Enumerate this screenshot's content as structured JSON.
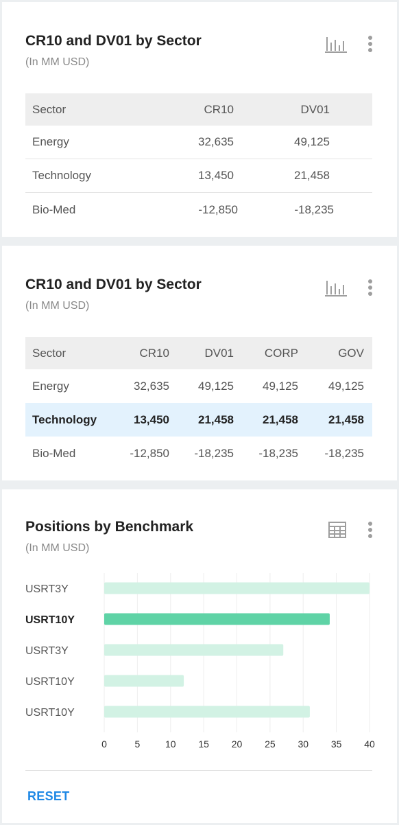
{
  "card1": {
    "title": "CR10 and DV01 by Sector",
    "subtitle": "(In MM USD)",
    "headers": [
      "Sector",
      "CR10",
      "DV01"
    ],
    "rows": [
      [
        "Energy",
        "32,635",
        "49,125"
      ],
      [
        "Technology",
        "13,450",
        "21,458"
      ],
      [
        "Bio-Med",
        "-12,850",
        "-18,235"
      ]
    ]
  },
  "card2": {
    "title": "CR10 and DV01 by Sector",
    "subtitle": "(In MM USD)",
    "headers": [
      "Sector",
      "CR10",
      "DV01",
      "CORP",
      "GOV"
    ],
    "rows": [
      [
        "Energy",
        "32,635",
        "49,125",
        "49,125",
        "49,125"
      ],
      [
        "Technology",
        "13,450",
        "21,458",
        "21,458",
        "21,458"
      ],
      [
        "Bio-Med",
        "-12,850",
        "-18,235",
        "-18,235",
        "-18,235"
      ]
    ],
    "highlighted_row": 1
  },
  "card3": {
    "title": "Positions by Benchmark",
    "subtitle": "(In MM USD)",
    "reset_label": "RESET",
    "chart_data": {
      "type": "bar",
      "orientation": "horizontal",
      "categories": [
        "USRT3Y",
        "USRT10Y",
        "USRT3Y",
        "USRT10Y",
        "USRT10Y"
      ],
      "values": [
        40,
        34,
        27,
        12,
        31
      ],
      "highlighted_index": 1,
      "xlim": [
        0,
        40
      ],
      "xticks": [
        0,
        5,
        10,
        15,
        20,
        25,
        30,
        35,
        40
      ],
      "grid": true,
      "colors": {
        "bar": "#d2f2e4",
        "bar_highlight": "#5fd3a6",
        "grid": "#eeeeee"
      }
    }
  },
  "colors": {
    "accent": "#1e88e5",
    "highlight_row": "#e3f2fd",
    "header_bg": "#eeeeee"
  }
}
